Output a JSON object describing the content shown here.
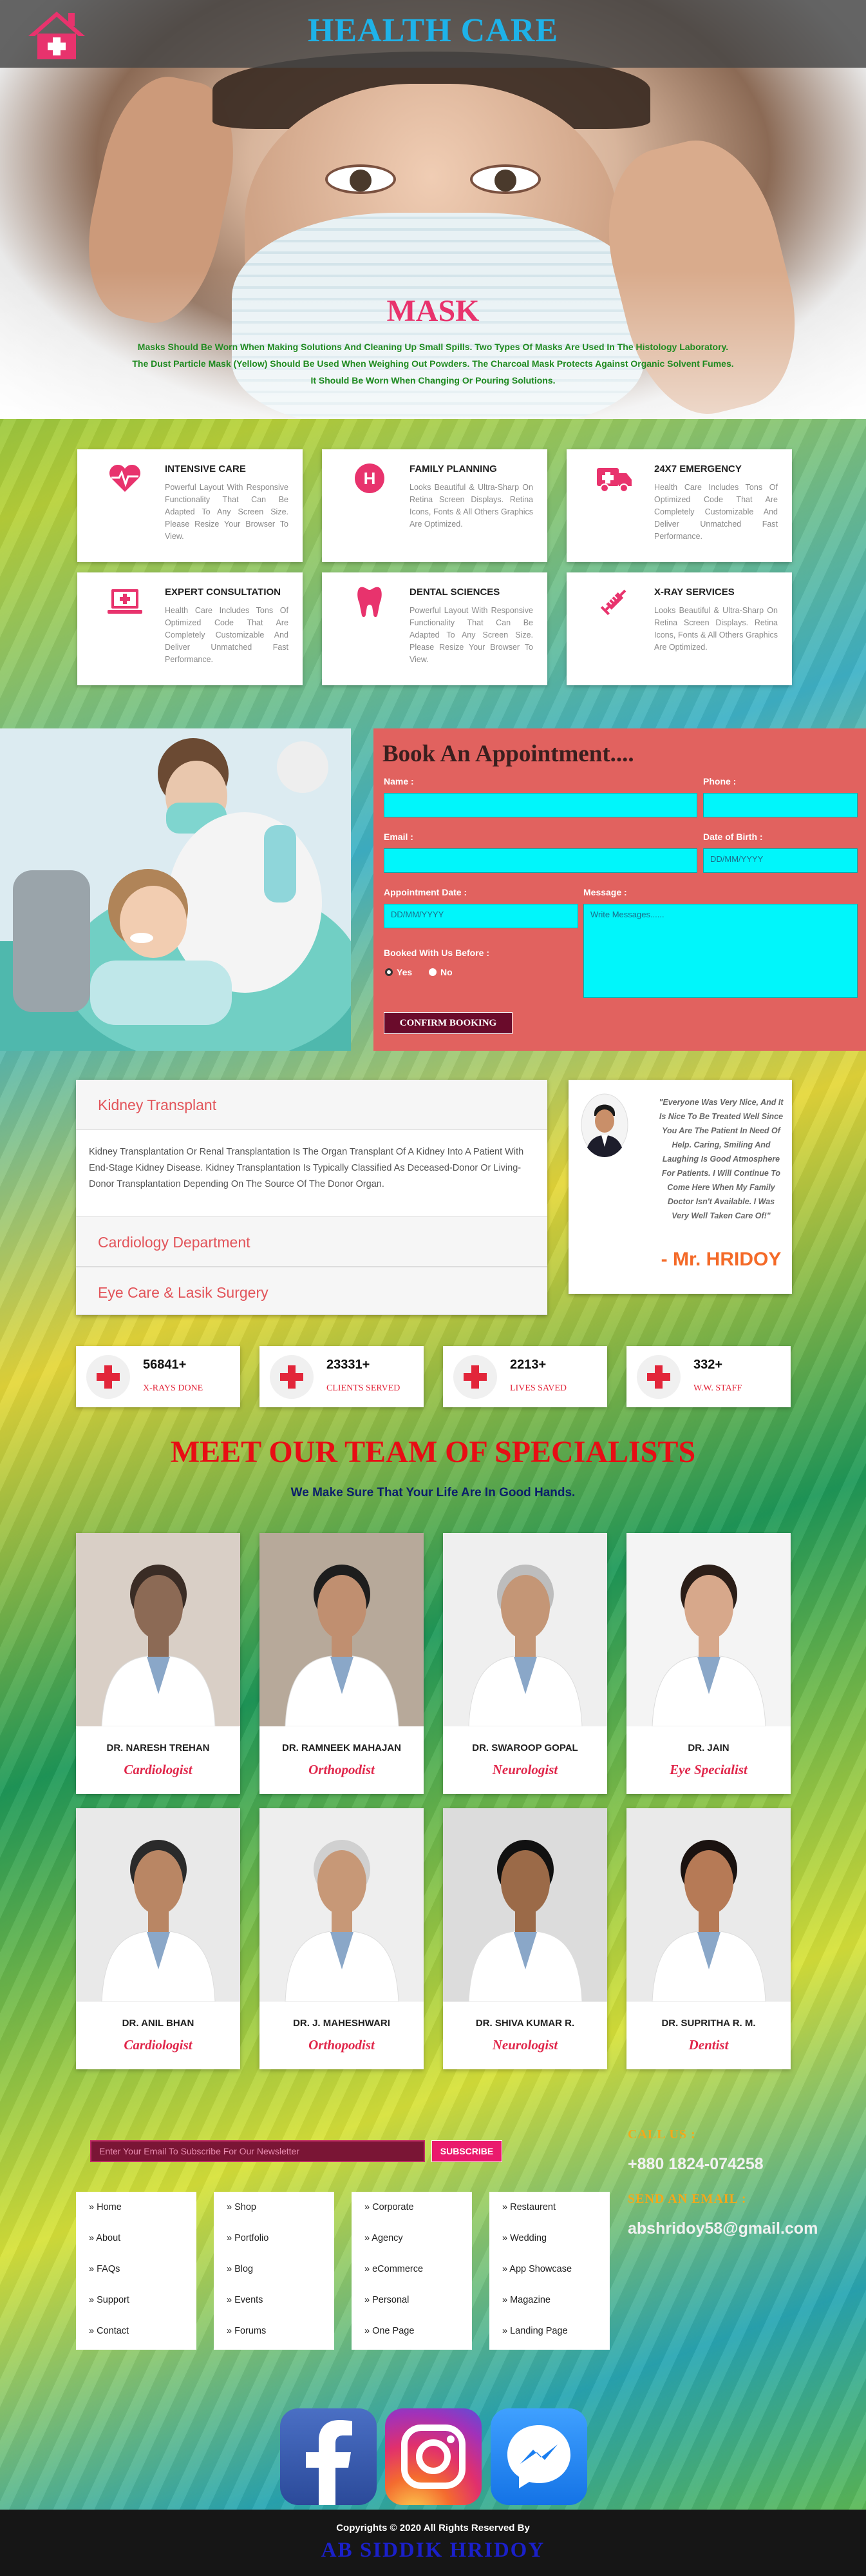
{
  "header": {
    "title": "HEALTH CARE",
    "logo_icon": "hospital-house-icon"
  },
  "hero": {
    "title": "MASK",
    "text": "Masks Should Be Worn When Making Solutions And Cleaning Up Small Spills. Two Types Of Masks Are Used In The Histology Laboratory. The Dust Particle Mask (Yellow) Should Be Used When Weighing Out Powders. The Charcoal Mask Protects Against Organic Solvent Fumes. It Should Be Worn When Changing Or Pouring Solutions."
  },
  "services": [
    {
      "title": "INTENSIVE CARE",
      "icon": "heartbeat-icon",
      "text": "Powerful Layout With Responsive Functionality That Can Be Adapted To Any Screen Size. Please Resize Your Browser To View."
    },
    {
      "title": "FAMILY PLANNING",
      "icon": "hospital-h-icon",
      "text": "Looks Beautiful & Ultra-Sharp On Retina Screen Displays. Retina Icons, Fonts & All Others Graphics Are Optimized."
    },
    {
      "title": "24X7 EMERGENCY",
      "icon": "ambulance-icon",
      "text": "Health Care Includes Tons Of Optimized Code That Are Completely Customizable And Deliver Unmatched Fast Performance."
    },
    {
      "title": "EXPERT CONSULTATION",
      "icon": "laptop-medical-icon",
      "text": "Health Care Includes Tons Of Optimized Code That Are Completely Customizable And Deliver Unmatched Fast Performance."
    },
    {
      "title": "DENTAL SCIENCES",
      "icon": "tooth-icon",
      "text": "Powerful Layout With Responsive Functionality That Can Be Adapted To Any Screen Size. Please Resize Your Browser To View."
    },
    {
      "title": "X-RAY SERVICES",
      "icon": "syringe-icon",
      "text": "Looks Beautiful & Ultra-Sharp On Retina Screen Displays. Retina Icons, Fonts & All Others Graphics Are Optimized."
    }
  ],
  "appointment": {
    "title": "Book An Appointment....",
    "name_label": "Name :",
    "phone_label": "Phone :",
    "email_label": "Email :",
    "dob_label": "Date of Birth :",
    "dob_placeholder": "DD/MM/YYYY",
    "appt_date_label": "Appointment Date :",
    "appt_date_placeholder": "DD/MM/YYYY",
    "message_label": "Message :",
    "message_placeholder": "Write Messages......",
    "booked_label": "Booked With Us Before :",
    "yes_label": "Yes",
    "no_label": "No",
    "confirm_button": "CONFIRM BOOKING"
  },
  "departments": {
    "items": [
      "Kidney Transplant",
      "Cardiology Department",
      "Eye Care & Lasik Surgery"
    ],
    "body": "Kidney Transplantation Or Renal Transplantation Is The Organ Transplant Of A Kidney Into A Patient With End-Stage Kidney Disease. Kidney Transplantation Is Typically Classified As Deceased-Donor Or Living-Donor Transplantation Depending On The Source Of The Donor Organ."
  },
  "testimonial": {
    "quote": "\"Everyone Was Very Nice, And It Is Nice To Be Treated Well Since You Are The Patient In Need Of Help. Caring, Smiling And Laughing Is Good Atmosphere For Patients. I Will Continue To Come Here When My Family Doctor Isn't Available. I Was Very Well Taken Care Of!\"",
    "name": "- Mr. HRIDOY"
  },
  "counters": [
    {
      "value": "56841+",
      "label": "X-RAYS DONE"
    },
    {
      "value": "23331+",
      "label": "CLIENTS SERVED"
    },
    {
      "value": "2213+",
      "label": "LIVES SAVED"
    },
    {
      "value": "332+",
      "label": "W.W. STAFF"
    }
  ],
  "team": {
    "title": "MEET OUR TEAM OF SPECIALISTS",
    "subtitle": "We Make Sure That Your Life Are In Good Hands.",
    "doctors": [
      {
        "name": "DR. NARESH TREHAN",
        "specialty": "Cardiologist"
      },
      {
        "name": "DR. RAMNEEK MAHAJAN",
        "specialty": "Orthopodist"
      },
      {
        "name": "DR. SWAROOP GOPAL",
        "specialty": "Neurologist"
      },
      {
        "name": "DR. JAIN",
        "specialty": "Eye Specialist"
      },
      {
        "name": "DR. ANIL BHAN",
        "specialty": "Cardiologist"
      },
      {
        "name": "DR. J. MAHESHWARI",
        "specialty": "Orthopodist"
      },
      {
        "name": "DR. SHIVA KUMAR R.",
        "specialty": "Neurologist"
      },
      {
        "name": "DR. SUPRITHA R. M.",
        "specialty": "Dentist"
      }
    ]
  },
  "footer": {
    "newsletter_placeholder": "Enter Your Email To Subscribe For Our Newsletter",
    "subscribe_button": "SUBSCRIBE",
    "columns": [
      [
        "» Home",
        "» About",
        "» FAQs",
        "» Support",
        "» Contact"
      ],
      [
        "» Shop",
        "» Portfolio",
        "» Blog",
        "» Events",
        "» Forums"
      ],
      [
        "» Corporate",
        "» Agency",
        "» eCommerce",
        "» Personal",
        "» One Page"
      ],
      [
        "» Restaurent",
        "» Wedding",
        "» App Showcase",
        "» Magazine",
        "» Landing Page"
      ]
    ],
    "call_label": "CALL US :",
    "phone": "+880 1824-074258",
    "email_label": "SEND AN EMAIL :",
    "email": "abshridoy58@gmail.com",
    "social": [
      "facebook-icon",
      "instagram-icon",
      "messenger-icon"
    ],
    "copyright": "Copyrights © 2020 All Rights Reserved By",
    "author": "AB SIDDIK HRIDOY"
  }
}
